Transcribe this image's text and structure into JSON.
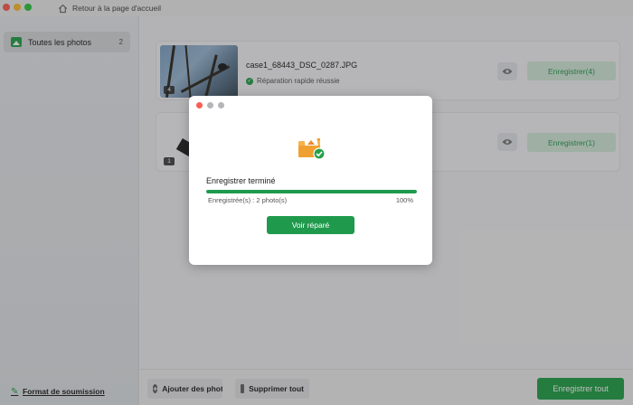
{
  "titlebar": {
    "home_label": "Retour à la page d'accueil"
  },
  "sidebar": {
    "items": [
      {
        "label": "Toutes les photos",
        "count": "2",
        "icon": "photos-icon"
      }
    ],
    "format_link": "Format de soumission"
  },
  "files": [
    {
      "name": "case1_68443_DSC_0287.JPG",
      "status": "Réparation rapide réussie",
      "badge": "4",
      "save_label": "Enregistrer(4)"
    },
    {
      "name": "",
      "status": "",
      "badge": "1",
      "save_label": "Enregistrer(1)"
    }
  ],
  "bottombar": {
    "add_label": "Ajouter des photos",
    "delete_label": "Supprimer tout",
    "save_all_label": "Enregistrer tout"
  },
  "modal": {
    "title": "Enregistrer terminé",
    "saved_text": "Enregistrée(s) : 2 photo(s)",
    "percent_text": "100%",
    "progress": 1.0,
    "button_label": "Voir réparé"
  },
  "colors": {
    "accent": "#1f9a4d",
    "accent_light": "#d3ead9",
    "close_dot": "#fd5d56"
  }
}
